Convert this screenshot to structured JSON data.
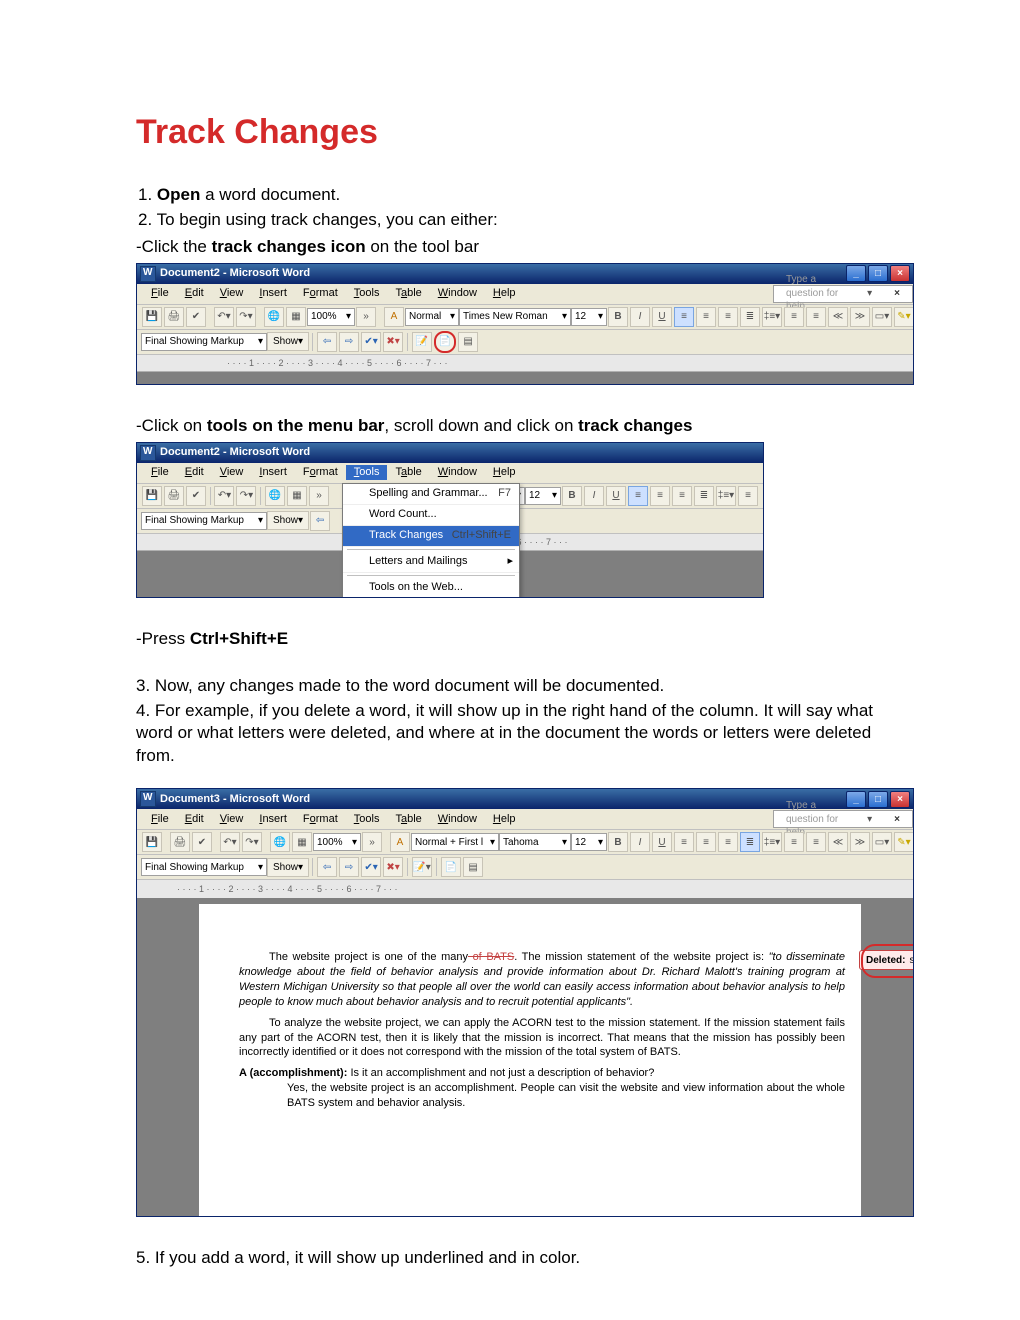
{
  "title": "Track Changes",
  "steps": {
    "s1_pre": "1.   ",
    "s1_open": "Open",
    "s1_post": " a word document.",
    "s2": "2.   To begin using track changes, you can either:",
    "s2a_pre": "-Click the ",
    "s2a_bold": "track changes icon",
    "s2a_post": " on the tool bar",
    "s2b_pre": "-Click on ",
    "s2b_bold": "tools on the menu bar",
    "s2b_mid": ", scroll down and click on ",
    "s2b_bold2": "track changes",
    "s2c_pre": "-Press ",
    "s2c_bold": "Ctrl+Shift+E",
    "s3": "3.  Now, any changes made to the word document will be documented.",
    "s4": "4.  For example, if you delete a word, it will show up in the right hand of the column.  It will say what word or what letters were deleted, and where at in the document the words or letters were deleted from.",
    "s5": "5.  If you add a word, it will show up underlined and in color."
  },
  "word_common": {
    "doc2": "Document2 - Microsoft Word",
    "doc3": "Document3 - Microsoft Word",
    "menus": [
      "File",
      "Edit",
      "View",
      "Insert",
      "Format",
      "Tools",
      "Table",
      "Window",
      "Help"
    ],
    "help_placeholder": "Type a question for help",
    "zoom": "100%",
    "font": "Times New Roman",
    "font2": "Normal + First l",
    "font2b": "Tahoma",
    "size": "12",
    "markup": "Final Showing Markup",
    "show": "Show",
    "ruler": "· · · · 1 · · · · 2 · · · · 3 · · · · 4 · · · · 5 · · · · 6 · · · · 7 · · ·",
    "normal": "Normal"
  },
  "tools_menu": {
    "spelling": "Spelling and Grammar...",
    "spelling_sc": "F7",
    "wordcount": "Word Count...",
    "track": "Track Changes",
    "track_sc": "Ctrl+Shift+E",
    "letters": "Letters and Mailings",
    "web": "Tools on the Web..."
  },
  "doc3_text": {
    "p1a": "The website project is one of the many",
    "p1_struck": " of BATS",
    "p1b": ".  The mission statement of the website project is:  ",
    "p1_quote": "\"to disseminate knowledge about the field of behavior analysis and provide information about Dr. Richard Malott's training program at Western Michigan University so that people all over the world can easily access information about behavior analysis to help people to know much about behavior analysis and to recruit potential applicants\".",
    "p2": "To analyze the website project, we can apply the ACORN test to the mission statement.  If the mission statement fails any part of the ACORN test, then it is likely that the mission is incorrect.  That means that the mission has possibly been incorrectly identified or it does not correspond with the mission of the total system of BATS.",
    "p3_bold": "A (accomplishment):",
    "p3_rest": "  Is it an accomplishment and not just a description of behavior?",
    "p3b": "Yes, the website project is an accomplishment.  People can visit the website and view information about the whole BATS system and behavior analysis.",
    "balloon_label": "Deleted:",
    "balloon_text": " subsystems"
  }
}
